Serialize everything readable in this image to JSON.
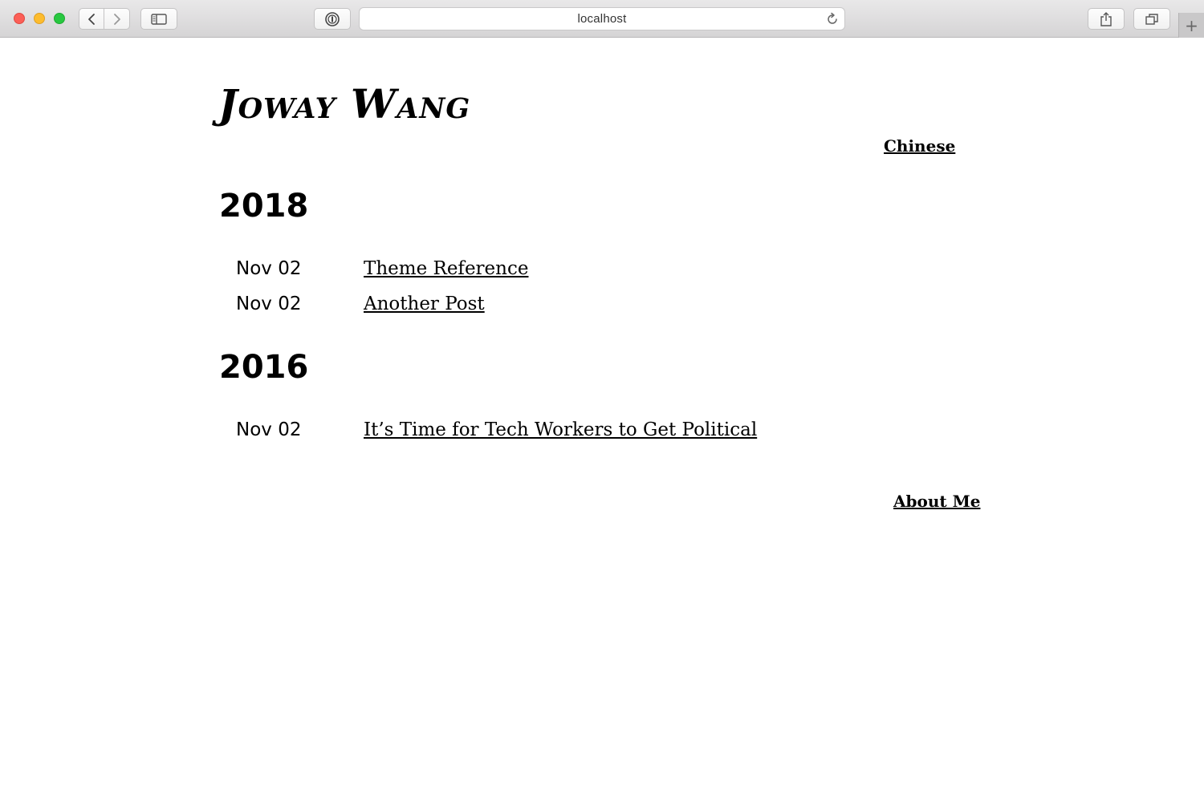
{
  "browser": {
    "address": "localhost",
    "icons": {
      "back": "chevron-left-icon",
      "forward": "chevron-right-icon",
      "sidebar": "sidebar-icon",
      "password": "password-manager-icon",
      "reload": "reload-icon",
      "share": "share-icon",
      "tabs": "tabs-overview-icon",
      "new_tab": "plus-icon"
    },
    "new_tab_glyph": "+"
  },
  "site": {
    "title": "Joway Wang",
    "language_link": "Chinese"
  },
  "archive": [
    {
      "year": "2018",
      "posts": [
        {
          "date": "Nov 02",
          "title": "Theme Reference"
        },
        {
          "date": "Nov 02",
          "title": "Another Post"
        }
      ]
    },
    {
      "year": "2016",
      "posts": [
        {
          "date": "Nov 02",
          "title": "It’s Time for Tech Workers to Get Political"
        }
      ]
    }
  ],
  "footer": {
    "about_link": "About Me"
  },
  "colors": {
    "text": "#000000",
    "background": "#ffffff",
    "close": "#fc5f57",
    "minimize": "#fdbc2e",
    "maximize": "#28c840"
  }
}
